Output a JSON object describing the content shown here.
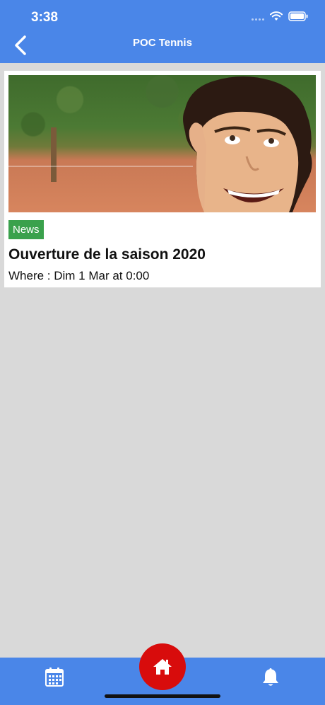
{
  "status_bar": {
    "time": "3:38",
    "icons": [
      "signal-icon",
      "wifi-icon",
      "battery-icon"
    ]
  },
  "nav": {
    "title": "POC Tennis",
    "back_icon": "chevron-left-icon"
  },
  "card": {
    "badge": "News",
    "title": "Ouverture de la saison 2020",
    "subtitle": "Where : Dim 1 Mar at 0:00"
  },
  "tab_bar": {
    "left_icon": "calendar-icon",
    "center_icon": "home-icon",
    "right_icon": "bell-icon"
  },
  "colors": {
    "primary": "#4a86e8",
    "badge": "#3aa14c",
    "home": "#d80c0c",
    "background": "#d9d9d9"
  }
}
